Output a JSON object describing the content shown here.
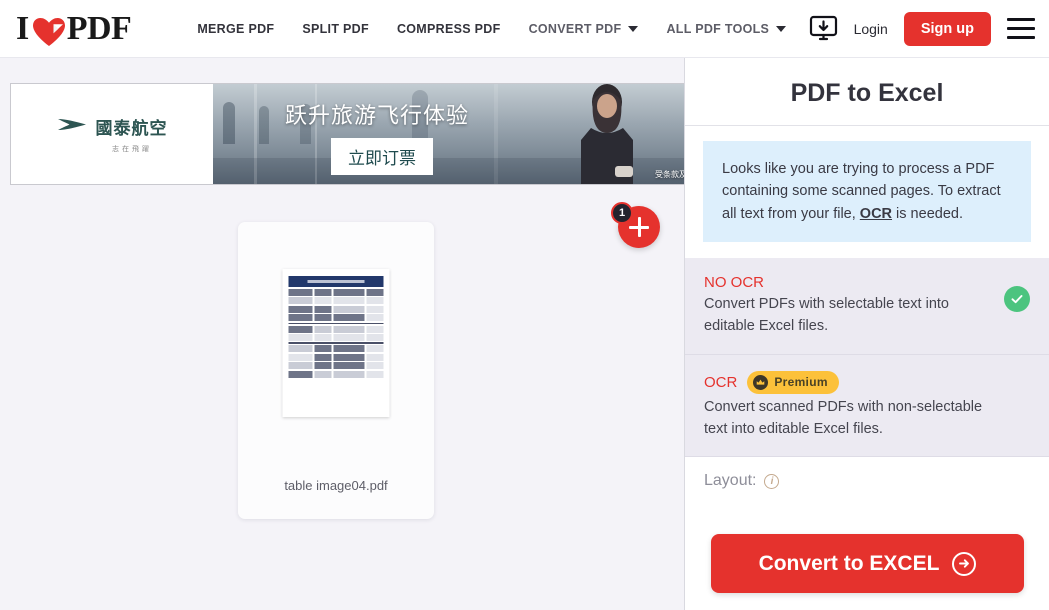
{
  "header": {
    "logo": {
      "first": "I",
      "heart_icon": "heart-icon",
      "second": "PDF"
    },
    "nav": [
      {
        "label": "MERGE PDF",
        "has_caret": false
      },
      {
        "label": "SPLIT PDF",
        "has_caret": false
      },
      {
        "label": "COMPRESS PDF",
        "has_caret": false
      },
      {
        "label": "CONVERT PDF",
        "has_caret": true
      },
      {
        "label": "ALL PDF TOOLS",
        "has_caret": true
      }
    ],
    "desktop_icon": "desktop-download-icon",
    "login_label": "Login",
    "signup_label": "Sign up",
    "menu_icon": "hamburger-menu-icon"
  },
  "ad": {
    "brand": "國泰航空",
    "tagline": "志在飛躍",
    "logo_icon": "cathay-brushwing-icon",
    "headline": "跃升旅游飞行体验",
    "cta_label": "立即订票",
    "fine_print": "受条款及细则约束"
  },
  "main": {
    "file": {
      "name": "table image04.pdf",
      "thumbnail_icon": "pdf-table-thumbnail"
    },
    "add_button": {
      "icon": "plus-icon",
      "badge_count": "1"
    }
  },
  "panel": {
    "title": "PDF to Excel",
    "info": {
      "text_before": "Looks like you are trying to process a PDF containing some scanned pages. To extract all text from your file, ",
      "link": "OCR",
      "text_after": " is needed."
    },
    "options": [
      {
        "label": "NO OCR",
        "description": "Convert PDFs with selectable text into editable Excel files.",
        "selected": true,
        "check_icon": "check-circle-icon",
        "badge": null
      },
      {
        "label": "OCR",
        "description": "Convert scanned PDFs with non-selectable text into editable Excel files.",
        "selected": false,
        "badge": {
          "label": "Premium",
          "icon": "crown-icon"
        }
      }
    ],
    "layout": {
      "label": "Layout:",
      "info_icon": "info-icon"
    },
    "convert_button": {
      "label": "Convert to EXCEL",
      "icon": "arrow-right-circle-icon"
    }
  },
  "colors": {
    "brand_red": "#e5322d",
    "info_blue": "#ddeffc",
    "option_bg": "#eceaf2",
    "check_green": "#4cc47f",
    "premium_yellow": "#fcc13a",
    "main_bg": "#f4f3f8",
    "ad_teal": "#2d5552"
  }
}
